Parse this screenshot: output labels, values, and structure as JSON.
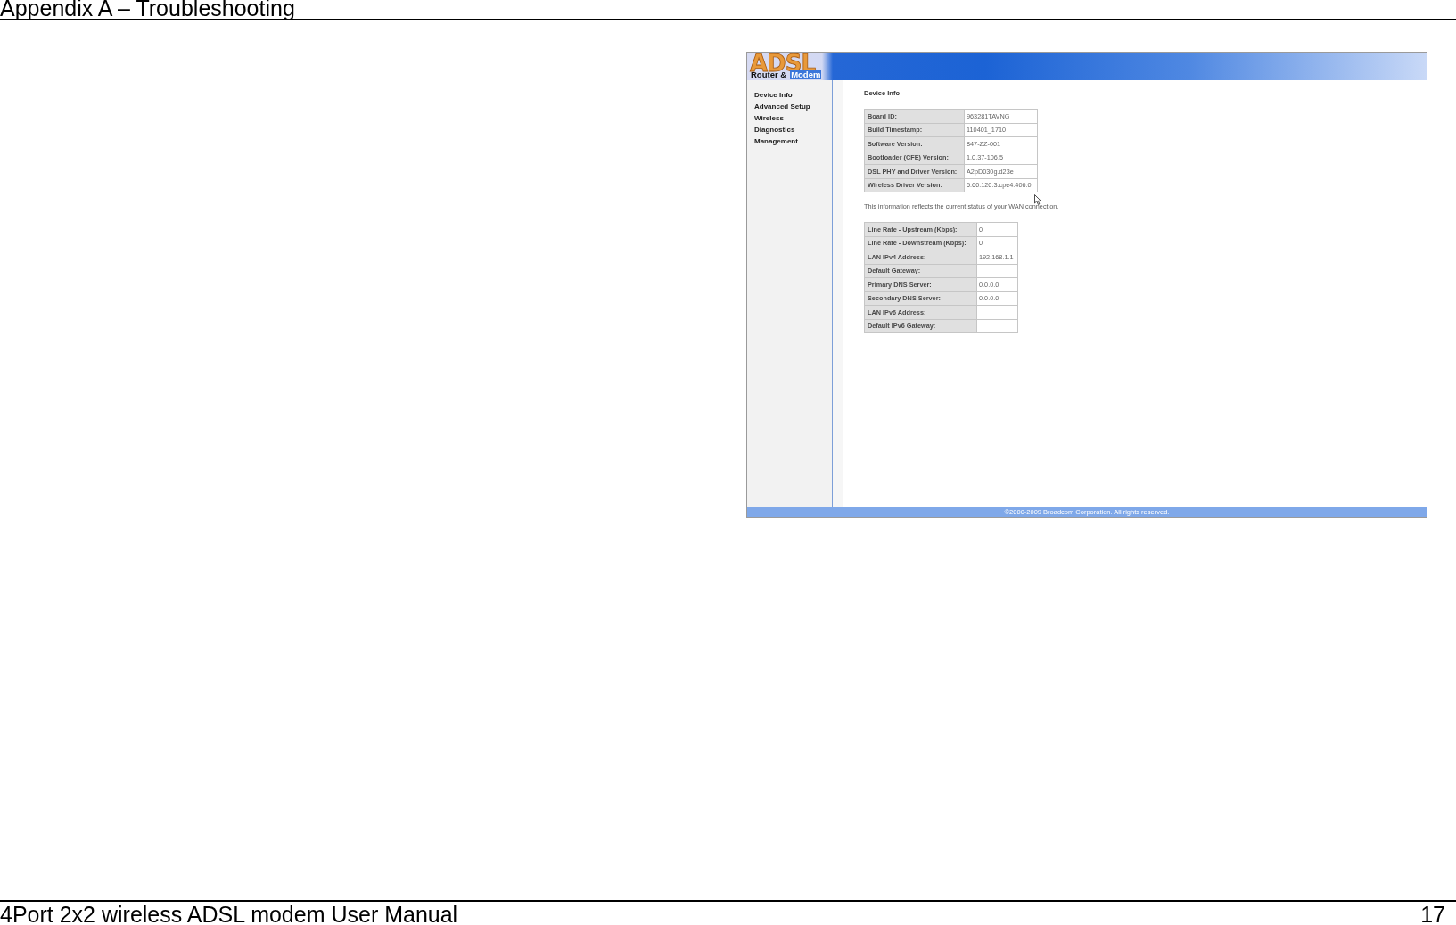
{
  "document": {
    "header": "Appendix A – Troubleshooting",
    "footer_title": "4Port 2x2 wireless ADSL modem User Manual",
    "page_number": "17"
  },
  "router_page": {
    "logo": {
      "letters": "ADSL",
      "words": [
        "Router &",
        "Modem"
      ]
    },
    "sidebar": {
      "items": [
        "Device Info",
        "Advanced Setup",
        "Wireless",
        "Diagnostics",
        "Management"
      ]
    },
    "title": "Device Info",
    "device_table": {
      "rows": [
        {
          "label": "Board ID:",
          "value": "963281TAVNG"
        },
        {
          "label": "Build Timestamp:",
          "value": "110401_1710"
        },
        {
          "label": "Software Version:",
          "value": "847-ZZ-001"
        },
        {
          "label": "Bootloader (CFE) Version:",
          "value": "1.0.37-106.5"
        },
        {
          "label": "DSL PHY and Driver Version:",
          "value": "A2pD030g.d23e"
        },
        {
          "label": "Wireless Driver Version:",
          "value": "5.60.120.3.cpe4.406.0"
        }
      ]
    },
    "note": "This information reflects the current status of your WAN connection.",
    "status_table": {
      "rows": [
        {
          "label": "Line Rate - Upstream (Kbps):",
          "value": "0"
        },
        {
          "label": "Line Rate - Downstream (Kbps):",
          "value": "0"
        },
        {
          "label": "LAN IPv4 Address:",
          "value": "192.168.1.1"
        },
        {
          "label": "Default Gateway:"
        },
        {
          "label": "Primary DNS Server:",
          "value": "0.0.0.0"
        },
        {
          "label": "Secondary DNS Server:",
          "value": "0.0.0.0"
        },
        {
          "label": "LAN IPv6 Address:"
        },
        {
          "label": "Default IPv6 Gateway:"
        }
      ]
    },
    "copyright": "©2000-2009 Broadcom Corporation. All rights reserved."
  }
}
